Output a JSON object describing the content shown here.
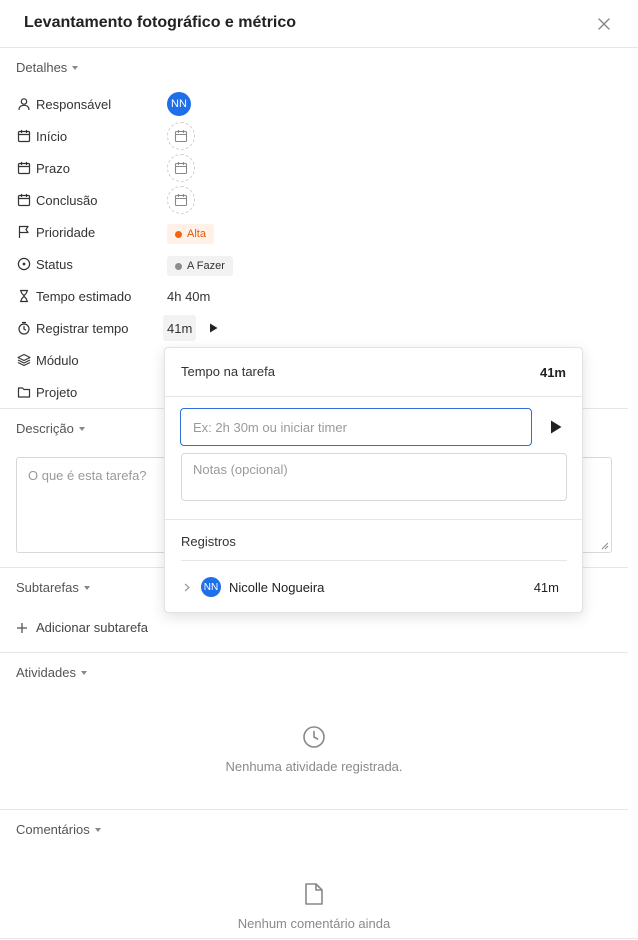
{
  "header": {
    "title": "Levantamento fotográfico e métrico"
  },
  "sections": {
    "details": "Detalhes",
    "description": "Descrição",
    "subtasks": "Subtarefas",
    "activities": "Atividades",
    "comments": "Comentários"
  },
  "properties": {
    "responsavel": {
      "label": "Responsável",
      "avatar": "NN"
    },
    "inicio": {
      "label": "Início"
    },
    "prazo": {
      "label": "Prazo"
    },
    "conclusao": {
      "label": "Conclusão"
    },
    "prioridade": {
      "label": "Prioridade",
      "value": "Alta",
      "color": "#f0650e"
    },
    "status": {
      "label": "Status",
      "value": "A Fazer",
      "color": "#8c8c8c"
    },
    "tempo_estimado": {
      "label": "Tempo estimado",
      "value": "4h 40m"
    },
    "registrar_tempo": {
      "label": "Registrar tempo",
      "value": "41m"
    },
    "modulo": {
      "label": "Módulo"
    },
    "projeto": {
      "label": "Projeto"
    }
  },
  "description": {
    "placeholder": "O que é esta tarefa?"
  },
  "subtasks": {
    "add_label": "Adicionar subtarefa"
  },
  "activities": {
    "empty": "Nenhuma atividade registrada."
  },
  "comments": {
    "empty": "Nenhum comentário ainda"
  },
  "popover": {
    "title": "Tempo na tarefa",
    "total": "41m",
    "time_placeholder": "Ex: 2h 30m ou iniciar timer",
    "notes_placeholder": "Notas (opcional)",
    "records_title": "Registros",
    "records": [
      {
        "avatar": "NN",
        "name": "Nicolle Nogueira",
        "time": "41m"
      }
    ]
  },
  "colors": {
    "accent": "#1f6fe8",
    "input_focus": "#2f6fd6"
  }
}
